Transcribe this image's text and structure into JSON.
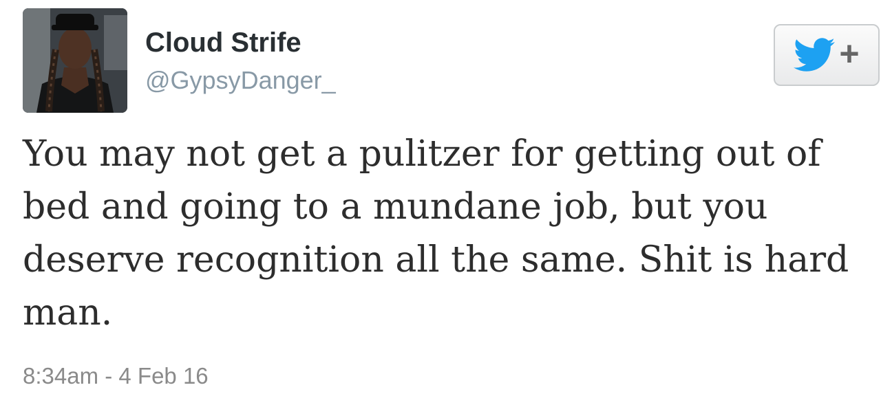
{
  "user": {
    "display_name": "Cloud Strife",
    "handle": "@GypsyDanger_",
    "avatar_icon": "profile-photo"
  },
  "follow_button": {
    "icon": "twitter-bird-icon",
    "plus_label": "+",
    "bird_color": "#1da1f2"
  },
  "tweet": {
    "text": "You may not get a pulitzer for getting out of bed and going to a mundane job, but you deserve recognition all the same. Shit is hard man.",
    "timestamp": "8:34am - 4 Feb 16"
  }
}
